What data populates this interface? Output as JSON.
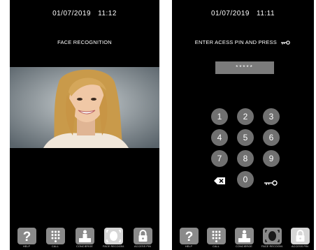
{
  "left_screen": {
    "date": "01/07/2019",
    "time": "11:12",
    "title": "FACE RECOGNITION"
  },
  "right_screen": {
    "date": "01/07/2019",
    "time": "11:11",
    "title": "ENTER ACESS PIN AND PRESS",
    "pin_value": "*****",
    "keys": [
      "1",
      "2",
      "3",
      "4",
      "5",
      "6",
      "7",
      "8",
      "9",
      "0"
    ]
  },
  "bottom_bar": {
    "help": "HELP",
    "call": "CALL",
    "concierge": "CONCIERGE",
    "face_recognition": "FACE RECOGNI.",
    "access_pin": "ACCESS PIN"
  },
  "colors": {
    "screen_bg": "#000000",
    "key_bg": "#707070",
    "tile_bg": "#8a8a8a",
    "active_tile_bg": "#d6d6d6"
  }
}
